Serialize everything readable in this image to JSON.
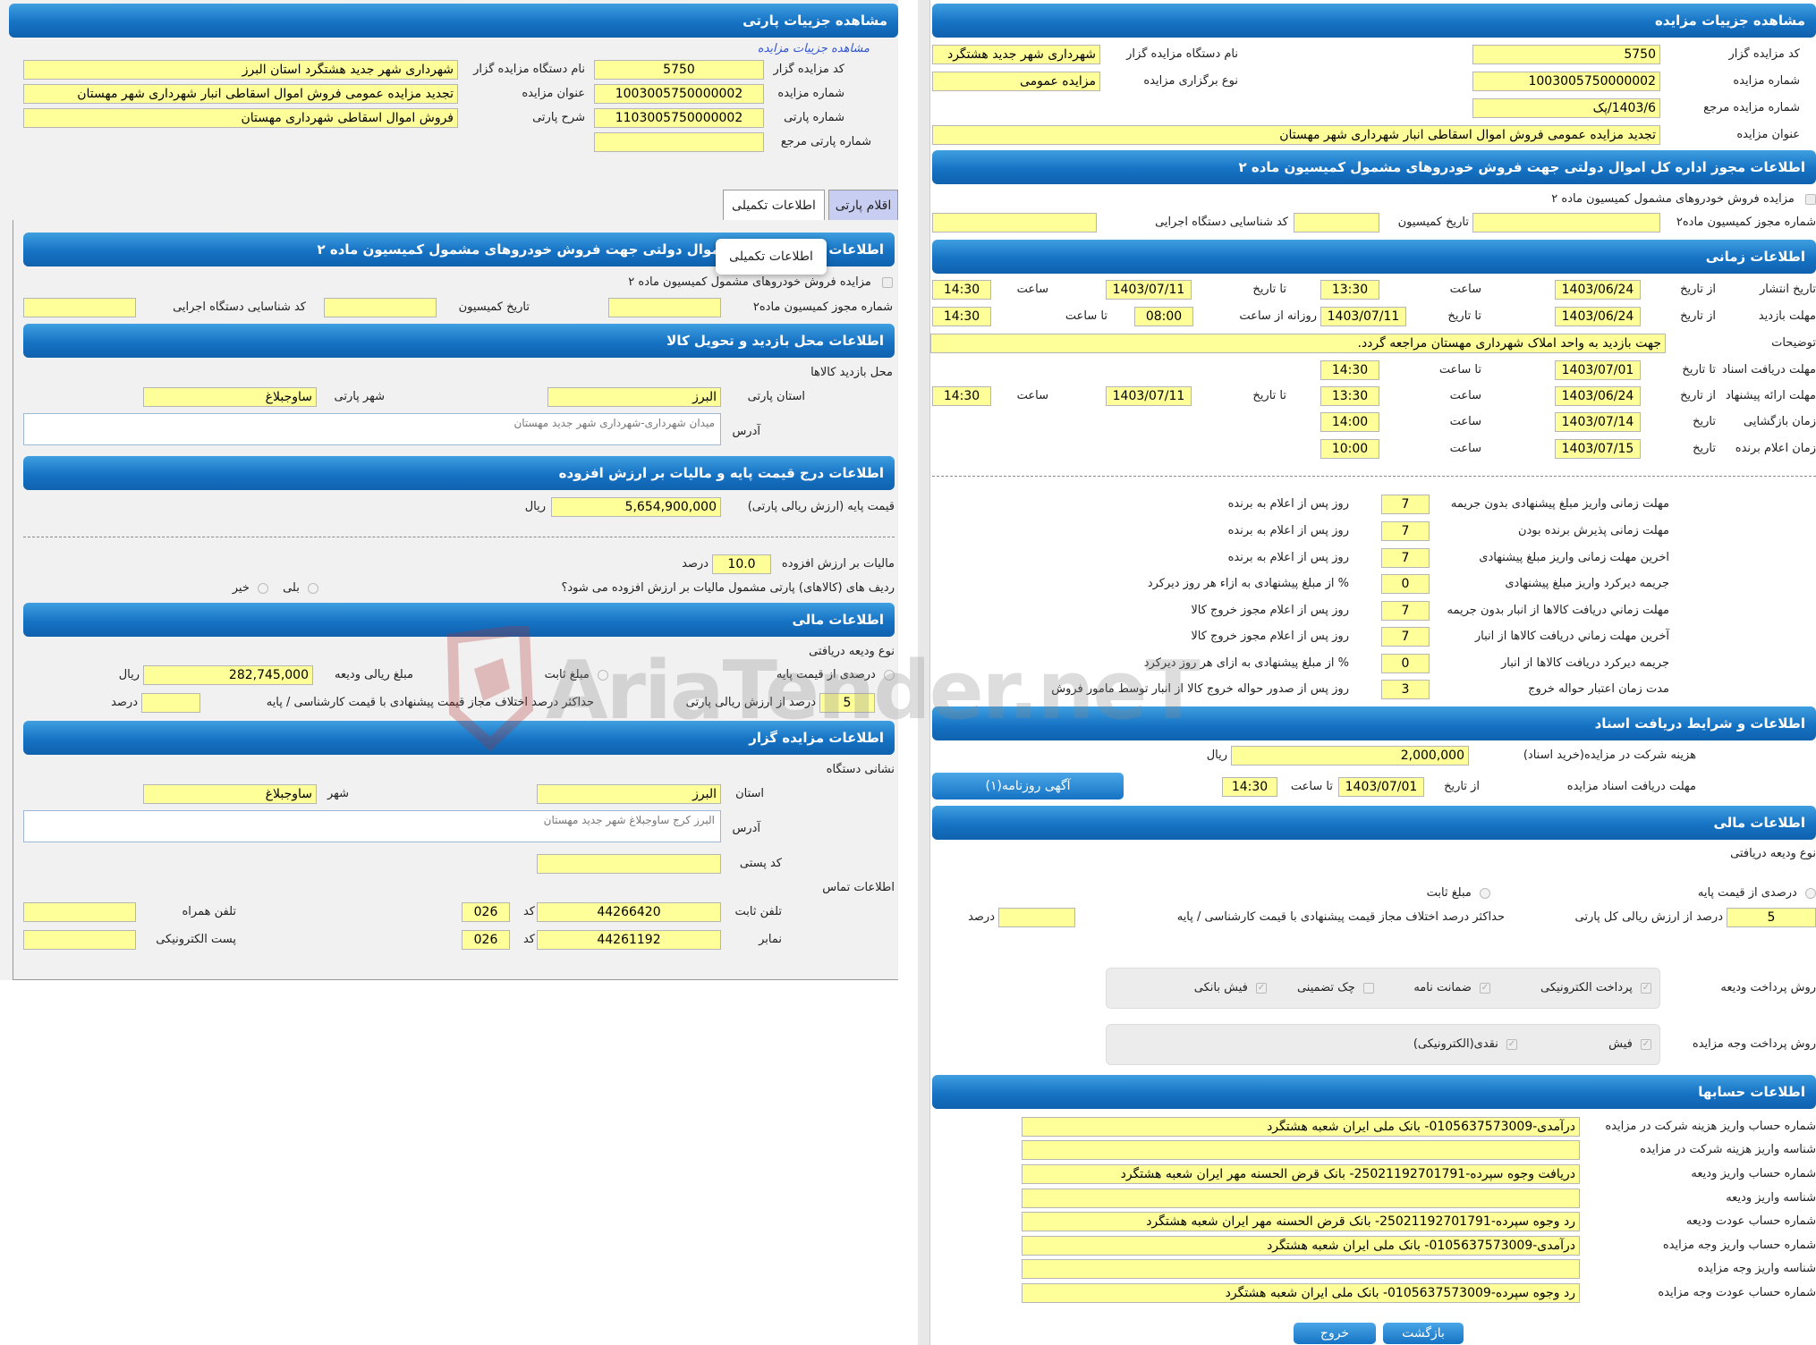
{
  "left": {
    "page_title": "مشاهده جزییات پارتی",
    "breadcrumb": "مشاهده جزییات مزایده",
    "top": {
      "code_label": "کد مزایده گزار",
      "code": "5750",
      "auction_no_label": "شماره مزایده",
      "auction_no": "1003005750000002",
      "party_no_label": "شماره پارتی",
      "party_no": "1103005750000002",
      "ref_party_label": "شماره پارتی مرجع",
      "org_label": "نام دستگاه مزایده گزار",
      "org": "شهرداری شهر جدید هشتگرد استان البرز",
      "title_label": "عنوان مزایده",
      "title": "تجدید مزایده عمومی فروش اموال اسقاطی انبار شهرداری شهر مهستان",
      "desc_label": "شرح پارتی",
      "desc": "فروش اموال اسقاطی شهرداری مهستان"
    },
    "tabs": {
      "items": "اقلام پارتی",
      "extra": "اطلاعات تکمیلی",
      "tooltip": "اطلاعات تکمیلی"
    },
    "permit": {
      "header": "اطلاعات مجوز اداره کل اموال دولتی جهت فروش خودروهای مشمول کمیسیون ماده ۲",
      "checkbox": "مزایده فروش خودروهای مشمول کمیسیون ماده ۲",
      "no_label": "شماره مجوز کمیسیون ماده۲",
      "date_label": "تاریخ کمیسیون",
      "id_label": "کد شناسایی دستگاه اجرایی"
    },
    "visit": {
      "header": "اطلاعات محل بازدید و تحویل کالا",
      "sub": "محل بازدید کالاها",
      "province_label": "استان پارتی",
      "province": "البرز",
      "city_label": "شهر پارتی",
      "city": "ساوجبلاغ",
      "address_label": "آدرس",
      "address": "میدان شهرداری-شهرداری شهر جدید مهستان"
    },
    "price": {
      "header": "اطلاعات درج قیمت پایه و مالیات بر ارزش افزوده",
      "base_label": "قیمت پایه (ارزش ریالی پارتی)",
      "base": "5,654,900,000",
      "base_unit": "ریال",
      "vat_label": "مالیات بر ارزش افزوده",
      "vat": "10.0",
      "vat_unit": "درصد",
      "vat_q": "ردیف های (کالاهای) پارتی مشمول مالیات بر ارزش افزوده می شود؟",
      "yes": "بلی",
      "no": "خیر"
    },
    "finance": {
      "header": "اطلاعات مالی",
      "deposit_type": "نوع ودیعه دریافتی",
      "percent_opt": "درصدی از قیمت پایه",
      "fixed_opt": "مبلغ ثابت",
      "deposit_label": "مبلغ ریالی ودیعه",
      "deposit": "282,745,000",
      "deposit_unit": "ریال",
      "pct": "5",
      "pct_label": "درصد از ارزش ریالی پارتی",
      "max_label": "حداکثر درصد اختلاف مجاز قیمت پیشنهادی با قیمت کارشناسی / پایه",
      "max_unit": "درصد"
    },
    "auctioneer": {
      "header": "اطلاعات مزایده گزار",
      "addr_sub": "نشانی دستگاه",
      "province_label": "استان",
      "province": "البرز",
      "city_label": "شهر",
      "city": "ساوجبلاغ",
      "address_label": "آدرس",
      "address": "البرز کرج ساوجبلاغ شهر جدید مهستان",
      "postal_label": "کد پستی",
      "contact_sub": "اطلاعات تماس",
      "phone_label": "تلفن ثابت",
      "phone": "44266420",
      "code_label": "کد",
      "phone_code": "026",
      "mobile_label": "تلفن همراه",
      "fax_label": "نمابر",
      "fax": "44261192",
      "fax_code": "026",
      "email_label": "پست الکترونیکی"
    }
  },
  "right": {
    "page_title": "مشاهده جزییات مزایده",
    "top": {
      "code_label": "کد مزایده گزار",
      "code": "5750",
      "org_label": "نام دستگاه مزایده گزار",
      "org": "شهرداری شهر جدید هشتگرد",
      "no_label": "شماره مزایده",
      "no": "1003005750000002",
      "type_label": "نوع برگزاری مزایده",
      "type": "مزایده عمومی",
      "ref_label": "شماره مزایده مرجع",
      "ref": "1403/6/پک",
      "title_label": "عنوان مزایده",
      "title": "تجدید مزایده عمومی فروش اموال اسقاطی انبار شهرداری شهر مهستان"
    },
    "permit": {
      "header": "اطلاعات مجوز اداره کل اموال دولتی جهت فروش خودروهای مشمول کمیسیون ماده ۲",
      "checkbox": "مزایده فروش خودروهای مشمول کمیسیون ماده ۲",
      "no_label": "شماره مجوز کمیسیون ماده۲",
      "date_label": "تاریخ کمیسیون",
      "id_label": "کد شناسایی دستگاه اجرایی"
    },
    "time": {
      "header": "اطلاعات زمانی",
      "from_date": "از تاریخ",
      "to_date": "تا تاریخ",
      "hour": "ساعت",
      "to_hour": "تا ساعت",
      "date": "تاریخ",
      "daily_from": "روزانه از ساعت",
      "pub_label": "تاریخ انتشار",
      "pub_from": "1403/06/24",
      "pub_from_h": "13:30",
      "pub_to": "1403/07/11",
      "pub_to_h": "14:30",
      "visit_label": "مهلت بازدید",
      "visit_from": "1403/06/24",
      "visit_to": "1403/07/11",
      "visit_h1": "08:00",
      "visit_h2": "14:30",
      "notes_label": "توضیحات",
      "notes": "جهت بازدید به واحد املاک شهرداری مهستان مراجعه گردد.",
      "doc_label": "مهلت دریافت اسناد",
      "doc_to": "1403/07/01",
      "doc_to_h": "14:30",
      "offer_label": "مهلت ارائه پیشنهاد",
      "offer_from": "1403/06/24",
      "offer_from_h": "13:30",
      "offer_to": "1403/07/11",
      "offer_to_h": "14:30",
      "open_label": "زمان بازگشایی",
      "open": "1403/07/14",
      "open_h": "14:00",
      "winner_label": "زمان اعلام برنده",
      "winner": "1403/07/15",
      "winner_h": "10:00"
    },
    "deadlines": [
      {
        "label": "مهلت زمانی واریز مبلغ پیشنهادی بدون جریمه",
        "value": "7",
        "unit": "روز پس از اعلام به برنده"
      },
      {
        "label": "مهلت زمانی پذیرش برنده بودن",
        "value": "7",
        "unit": "روز پس از اعلام به برنده"
      },
      {
        "label": "اخرین مهلت زمانی واریز مبلغ پیشنهادی",
        "value": "7",
        "unit": "روز پس از اعلام به برنده"
      },
      {
        "label": "جریمه دیرکرد واریز مبلغ پیشنهادی",
        "value": "0",
        "unit": "% از مبلغ پیشنهادی به ازاء هر روز دیرکرد"
      },
      {
        "label": "مهلت زماني دريافت كالاها از انبار بدون جريمه",
        "value": "7",
        "unit": "روز پس از اعلام مجوز خروج کالا"
      },
      {
        "label": "آخرين مهلت زماني دريافت كالاها از انبار",
        "value": "7",
        "unit": "روز پس از اعلام مجوز خروج کالا"
      },
      {
        "label": "جريمه ديركرد دريافت كالاها از انبار",
        "value": "0",
        "unit": "% از مبلغ پیشنهادی به ازای هر روز دیرکرد"
      },
      {
        "label": "مدت زمان اعتبار حواله خروج",
        "value": "3",
        "unit": "روز پس از صدور حواله خروج کالا از انبار توسط مامور فروش"
      }
    ],
    "docs": {
      "header": "اطلاعات و شرایط دریافت اسناد",
      "fee_label": "هزینه شرکت در مزایده(خرید اسناد)",
      "fee": "2,000,000",
      "fee_unit": "ریال",
      "deadline_label": "مهلت دریافت اسناد مزایده",
      "from_label": "از تاریخ",
      "date": "1403/07/01",
      "to_h_label": "تا ساعت",
      "hour": "14:30",
      "news_button": "آگهی روزنامه(۱)"
    },
    "finance": {
      "header": "اطلاعات مالی",
      "deposit_type": "نوع ودیعه دریافتی",
      "percent_opt": "درصدی از قیمت پایه",
      "fixed_opt": "مبلغ ثابت",
      "pct": "5",
      "pct_label": "درصد از ارزش ریالی کل پارتی",
      "max_label": "حداکثر درصد اختلاف مجاز قیمت پیشنهادی با قیمت کارشناسی / پایه",
      "max_unit": "درصد",
      "dep_method_label": "روش پرداخت ودیعه",
      "dep_methods": [
        "پرداخت الکترونیکی",
        "ضمانت نامه",
        "چک تضمینی",
        "فیش بانکی"
      ],
      "pay_method_label": "روش پرداخت وجه مزایده",
      "pay_methods": [
        "فیش",
        "نقدی(الکترونیکی)"
      ]
    },
    "accounts": {
      "header": "اطلاعات حسابها",
      "rows": [
        {
          "label": "شماره حساب واریز هزینه شرکت در مزایده",
          "value": "درآمدی-0105637573009- بانک ملی ایران شعبه هشتگرد"
        },
        {
          "label": "شناسه واریز هزینه شرکت در مزایده",
          "value": ""
        },
        {
          "label": "شماره حساب واریز ودیعه",
          "value": "دریافت وجوه سپرده-25021192701791- بانک قرض الحسنه مهر ایران شعبه هشتگرد"
        },
        {
          "label": "شناسه واریز ودیعه",
          "value": ""
        },
        {
          "label": "شماره حساب عودت ودیعه",
          "value": "رد وجوه سپرده-25021192701791- بانک قرض الحسنه مهر ایران شعبه هشتگرد"
        },
        {
          "label": "شماره حساب واریز وجه مزایده",
          "value": "درآمدی-0105637573009- بانک ملی ایران شعبه هشتگرد"
        },
        {
          "label": "شناسه واریز وجه مزایده",
          "value": ""
        },
        {
          "label": "شماره حساب عودت وجه مزایده",
          "value": "رد وجوه سپرده-0105637573009- بانک ملی ایران شعبه هشتگرد"
        }
      ]
    },
    "buttons": {
      "back": "بازگشت",
      "exit": "خروج"
    }
  },
  "watermark": "AriaTender.neT"
}
